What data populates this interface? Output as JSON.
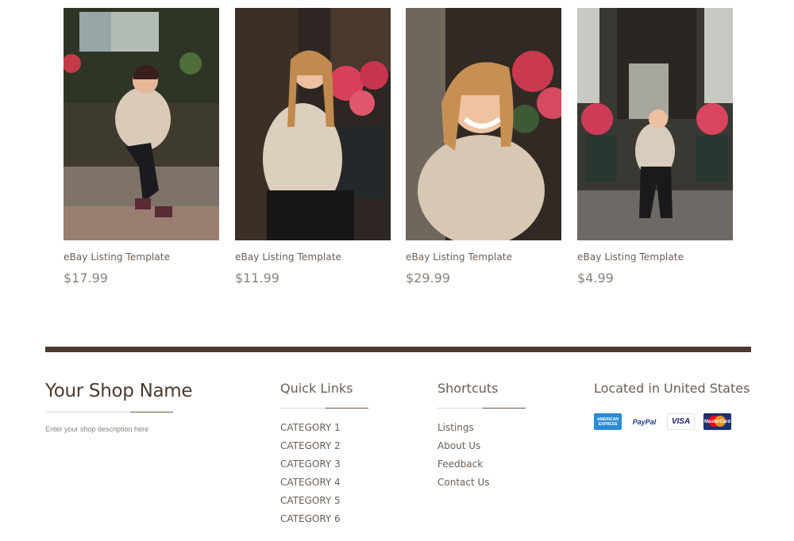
{
  "products": [
    {
      "name": "eBay Listing Template",
      "price": "$17.99"
    },
    {
      "name": "eBay Listing Template",
      "price": "$11.99"
    },
    {
      "name": "eBay Listing Template",
      "price": "$29.99"
    },
    {
      "name": "eBay Listing Template",
      "price": "$4.99"
    }
  ],
  "footer": {
    "shop_name": "Your Shop Name",
    "shop_description": "Enter your shop description here",
    "quick_links": {
      "title": "Quick Links",
      "items": [
        "CATEGORY 1",
        "CATEGORY 2",
        "CATEGORY 3",
        "CATEGORY 4",
        "CATEGORY 5",
        "CATEGORY 6"
      ]
    },
    "shortcuts": {
      "title": "Shortcuts",
      "items": [
        "Listings",
        "About Us",
        "Feedback",
        "Contact Us"
      ]
    },
    "location": {
      "title": "Located in United States",
      "payment_methods": [
        "AMERICAN EXPRESS",
        "PayPal",
        "VISA",
        "MasterCard"
      ]
    }
  },
  "colors": {
    "divider": "#4b3a2f",
    "heading": "#4b3a2f",
    "text": "#6b5e55"
  }
}
